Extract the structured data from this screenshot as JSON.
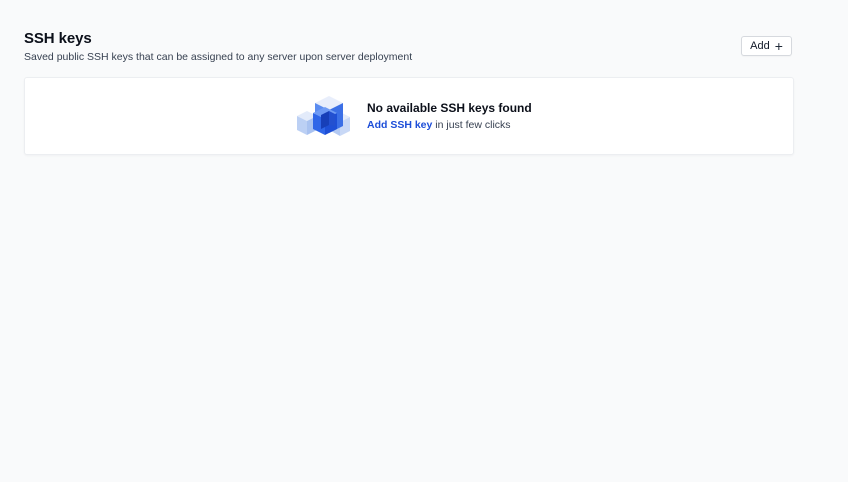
{
  "header": {
    "title": "SSH keys",
    "subtitle": "Saved public SSH keys that can be assigned to any server upon server deployment",
    "add_button_label": "Add",
    "add_button_icon": "plus-icon"
  },
  "empty_state": {
    "illustration_icon": "cubes-illustration-icon",
    "title": "No available SSH keys found",
    "link_text": "Add SSH key",
    "description_suffix": " in just few clicks"
  },
  "colors": {
    "background": "#f9fafb",
    "card": "#ffffff",
    "link": "#1d4ed8",
    "title": "#0b0f19",
    "muted": "#374151"
  }
}
